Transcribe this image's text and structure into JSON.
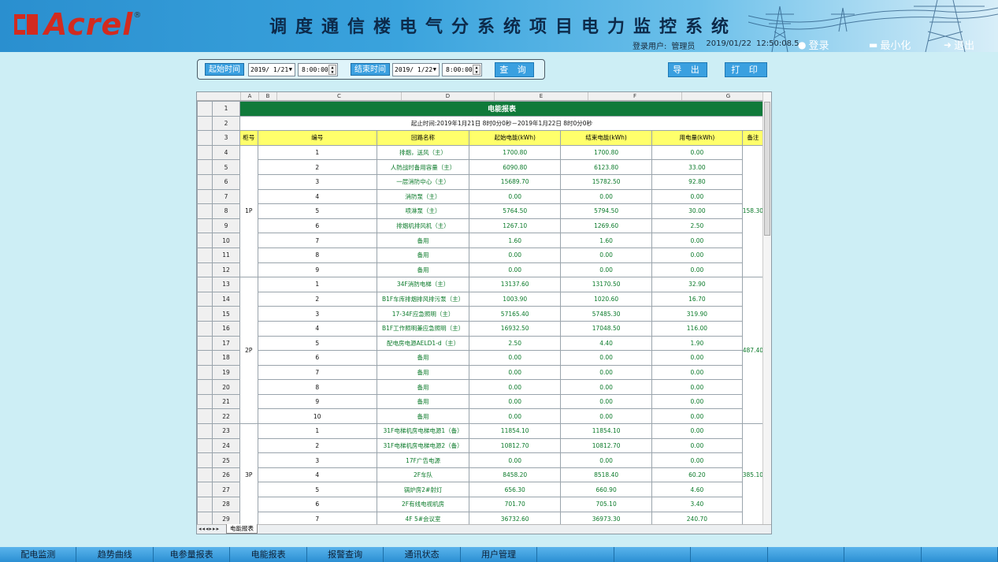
{
  "header": {
    "brand": "Acrel",
    "brand_reg": "®",
    "title": "调度通信楼电气分系统项目电力监控系统",
    "user_label": "登录用户:",
    "user_name": "管理员",
    "date": "2019/01/22",
    "time": "12:50:08.5",
    "login_label": "登录",
    "minimize_label": "最小化",
    "exit_label": "退出"
  },
  "query": {
    "start_label": "起始时间",
    "start_date": "2019/ 1/21",
    "start_time": "8:00:00",
    "end_label": "结束时间",
    "end_date": "2019/ 1/22",
    "end_time": "8:00:00",
    "search_label": "查 询",
    "export_label": "导 出",
    "print_label": "打 印"
  },
  "sheet": {
    "col_letters": [
      "A",
      "B",
      "C",
      "D",
      "E",
      "F",
      "G"
    ],
    "title": "电能报表",
    "period": "起止时间:2019年1月21日 8时0分0秒－2019年1月22日 8时0分0秒",
    "headers": [
      "柜号",
      "编号",
      "回路名称",
      "起始电能(kWh)",
      "结束电能(kWh)",
      "用电量(kWh)",
      "备注"
    ],
    "groups": [
      {
        "cabinet": "1P",
        "remark": "158.30",
        "rows": [
          [
            "1",
            "排烟，送风（主）",
            "1700.80",
            "1700.80",
            "0.00"
          ],
          [
            "2",
            "人防战时备用容量（主）",
            "6090.80",
            "6123.80",
            "33.00"
          ],
          [
            "3",
            "一层消防中心（主）",
            "15689.70",
            "15782.50",
            "92.80"
          ],
          [
            "4",
            "消防泵（主）",
            "0.00",
            "0.00",
            "0.00"
          ],
          [
            "5",
            "喷淋泵（主）",
            "5764.50",
            "5794.50",
            "30.00"
          ],
          [
            "6",
            "排烟机排风机（主）",
            "1267.10",
            "1269.60",
            "2.50"
          ],
          [
            "7",
            "备用",
            "1.60",
            "1.60",
            "0.00"
          ],
          [
            "8",
            "备用",
            "0.00",
            "0.00",
            "0.00"
          ],
          [
            "9",
            "备用",
            "0.00",
            "0.00",
            "0.00"
          ]
        ]
      },
      {
        "cabinet": "2P",
        "remark": "487.40",
        "rows": [
          [
            "1",
            "34F消防电梯（主）",
            "13137.60",
            "13170.50",
            "32.90"
          ],
          [
            "2",
            "B1F车库排烟排风排污泵（主）",
            "1003.90",
            "1020.60",
            "16.70"
          ],
          [
            "3",
            "17-34F应急照明（主）",
            "57165.40",
            "57485.30",
            "319.90"
          ],
          [
            "4",
            "B1F工作照明兼应急照明（主）",
            "16932.50",
            "17048.50",
            "116.00"
          ],
          [
            "5",
            "配电房电源AELD1-d（主）",
            "2.50",
            "4.40",
            "1.90"
          ],
          [
            "6",
            "备用",
            "0.00",
            "0.00",
            "0.00"
          ],
          [
            "7",
            "备用",
            "0.00",
            "0.00",
            "0.00"
          ],
          [
            "8",
            "备用",
            "0.00",
            "0.00",
            "0.00"
          ],
          [
            "9",
            "备用",
            "0.00",
            "0.00",
            "0.00"
          ],
          [
            "10",
            "备用",
            "0.00",
            "0.00",
            "0.00"
          ]
        ]
      },
      {
        "cabinet": "3P",
        "remark": "385.10",
        "rows": [
          [
            "1",
            "31F电梯机房电梯电源1（备）",
            "11854.10",
            "11854.10",
            "0.00"
          ],
          [
            "2",
            "31F电梯机房电梯电源2（备）",
            "10812.70",
            "10812.70",
            "0.00"
          ],
          [
            "3",
            "17F广告电源",
            "0.00",
            "0.00",
            "0.00"
          ],
          [
            "4",
            "2F车队",
            "8458.20",
            "8518.40",
            "60.20"
          ],
          [
            "5",
            "锅炉房2#射灯",
            "656.30",
            "660.90",
            "4.60"
          ],
          [
            "6",
            "2F有线电视机房",
            "701.70",
            "705.10",
            "3.40"
          ],
          [
            "7",
            "4F 5#会议室",
            "36732.60",
            "36973.30",
            "240.70"
          ]
        ]
      }
    ],
    "tab_nav": "◂◂◂▸▸▸",
    "tab_name": "电能报表"
  },
  "nav": [
    "配电监测",
    "趋势曲线",
    "电参量报表",
    "电能报表",
    "报警查询",
    "通讯状态",
    "用户管理",
    "",
    "",
    "",
    "",
    "",
    ""
  ],
  "colors": {
    "title_bg": "#107a3a",
    "header_bg": "#ffff6b",
    "value_text": "#0b7a2a",
    "accent": "#3aa0e0"
  }
}
